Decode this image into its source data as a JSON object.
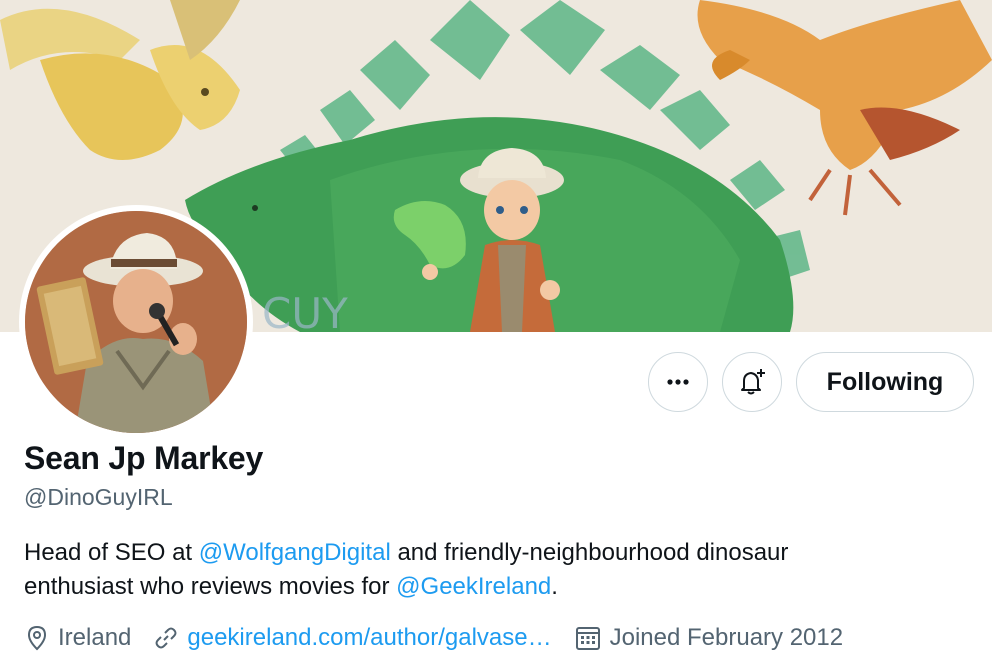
{
  "banner": {
    "description_icon": "dinosaur-illustration-banner",
    "text_fragment": "CUY"
  },
  "avatar": {
    "icon": "profile-photo"
  },
  "actions": {
    "more_icon": "more-dots-icon",
    "notify_icon": "bell-plus-icon",
    "following_label": "Following"
  },
  "profile": {
    "name": "Sean Jp Markey",
    "handle": "@DinoGuyIRL",
    "bio": {
      "line1_prefix": "Head of SEO at ",
      "mention1": "@WolfgangDigital",
      "line1_suffix": " and friendly-neighbourhood dinosaur",
      "line2_prefix": "enthusiast who reviews movies for ",
      "mention2": "@GeekIreland",
      "line2_suffix": "."
    },
    "meta": {
      "location": "Ireland",
      "url": "geekireland.com/author/galvase…",
      "joined": "Joined February 2012"
    }
  },
  "colors": {
    "accent": "#1d9bf0",
    "text": "#0f1419",
    "muted": "#536471",
    "border": "#cfd9de"
  }
}
